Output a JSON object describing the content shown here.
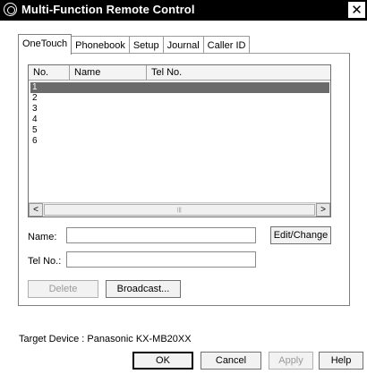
{
  "window": {
    "title": "Multi-Function Remote Control"
  },
  "tabs": [
    {
      "label": "OneTouch"
    },
    {
      "label": "Phonebook"
    },
    {
      "label": "Setup"
    },
    {
      "label": "Journal"
    },
    {
      "label": "Caller ID"
    }
  ],
  "list": {
    "columns": [
      "No.",
      "Name",
      "Tel No."
    ],
    "rows": [
      {
        "no": "1",
        "selected": true
      },
      {
        "no": "2"
      },
      {
        "no": "3"
      },
      {
        "no": "4"
      },
      {
        "no": "5"
      },
      {
        "no": "6"
      }
    ],
    "scroll_left": "<",
    "scroll_right": ">"
  },
  "form": {
    "name_label": "Name:",
    "tel_label": "Tel No.:",
    "name_value": "",
    "tel_value": "",
    "edit_change_label": "Edit/Change",
    "delete_label": "Delete",
    "broadcast_label": "Broadcast..."
  },
  "footer": {
    "target_device": "Target Device : Panasonic KX-MB20XX",
    "ok_label": "OK",
    "cancel_label": "Cancel",
    "apply_label": "Apply",
    "help_label": "Help"
  },
  "icons": {
    "title": "remote-control-icon",
    "close": "close-icon"
  }
}
